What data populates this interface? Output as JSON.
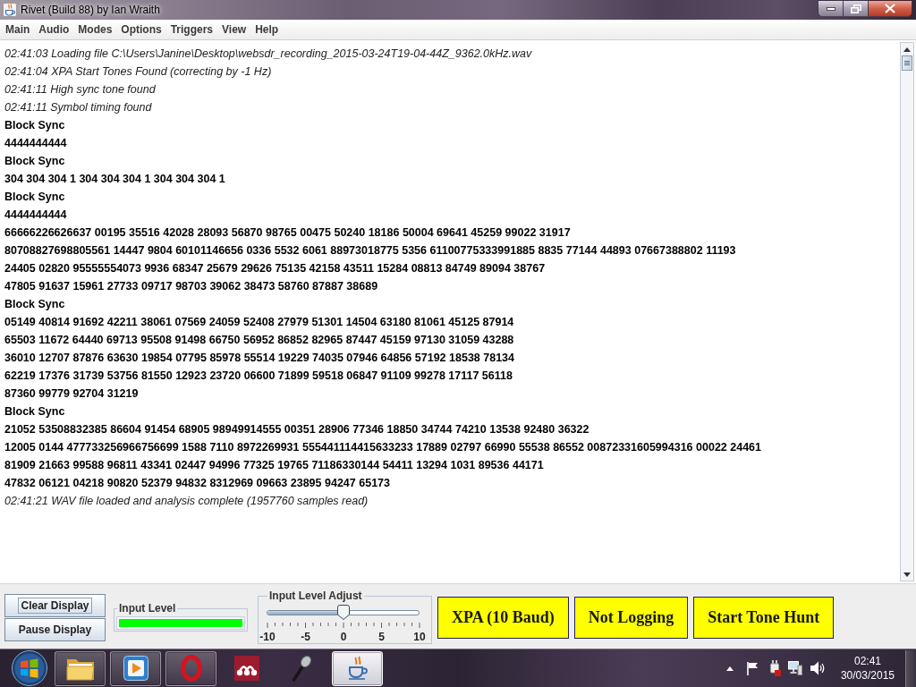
{
  "window": {
    "title": "Rivet (Build 88) by Ian Wraith"
  },
  "menu": [
    "Main",
    "Audio",
    "Modes",
    "Options",
    "Triggers",
    "View",
    "Help"
  ],
  "log": [
    {
      "kind": "status",
      "text": "02:41:03 Loading file C:\\Users\\Janine\\Desktop\\websdr_recording_2015-03-24T19-04-44Z_9362.0kHz.wav"
    },
    {
      "kind": "status",
      "text": "02:41:04 XPA Start Tones Found (correcting by -1 Hz)"
    },
    {
      "kind": "status",
      "text": "02:41:11 High sync tone found"
    },
    {
      "kind": "status",
      "text": "02:41:11 Symbol timing found"
    },
    {
      "kind": "data",
      "text": "Block Sync"
    },
    {
      "kind": "data",
      "text": "4444444444"
    },
    {
      "kind": "data",
      "text": "Block Sync"
    },
    {
      "kind": "data",
      "text": "304 304 304 1 304 304 304 1 304 304 304 1"
    },
    {
      "kind": "data",
      "text": "Block Sync"
    },
    {
      "kind": "data",
      "text": "4444444444"
    },
    {
      "kind": "data",
      "text": "66666226626637 00195 35516 42028 28093 56870 98765 00475 50240 18186 50004 69641 45259 99022 31917"
    },
    {
      "kind": "data",
      "text": "80708827698805561 14447 9804 60101146656 0336 5532 6061 88973018775 5356 61100775333991885 8835 77144 44893 07667388802 11193"
    },
    {
      "kind": "data",
      "text": "24405 02820 95555554073 9936 68347 25679 29626 75135 42158 43511 15284 08813 84749 89094 38767"
    },
    {
      "kind": "data",
      "text": "47805 91637 15961 27733 09717 98703 39062 38473 58760 87887 38689"
    },
    {
      "kind": "data",
      "text": "Block Sync"
    },
    {
      "kind": "data",
      "text": "05149 40814 91692 42211 38061 07569 24059 52408 27979 51301 14504 63180 81061 45125 87914"
    },
    {
      "kind": "data",
      "text": "65503 11672 64440 69713 95508 91498 66750 56952 86852 82965 87447 45159 97130 31059 43288"
    },
    {
      "kind": "data",
      "text": "36010 12707 87876 63630 19854 07795 85978 55514 19229 74035 07946 64856 57192 18538 78134"
    },
    {
      "kind": "data",
      "text": "62219 17376 31739 53756 81550 12923 23720 06600 71899 59518 06847 91109 99278 17117 56118"
    },
    {
      "kind": "data",
      "text": "87360 99779 92704 31219"
    },
    {
      "kind": "data",
      "text": "Block Sync"
    },
    {
      "kind": "data",
      "text": "21052 53508832385 86604 91454 68905 98949914555 00351 28906 77346 18850 34744 74210 13538 92480 36322"
    },
    {
      "kind": "data",
      "text": "12005 0144 477733256966756699 1588 7110 8972269931 555441114415633233 17889 02797 66990 55538 86552 00872331605994316 00022 24461"
    },
    {
      "kind": "data",
      "text": "81909 21663 99588 96811 43341 02447 94996 77325 19765 71186330144 54411 13294 1031 89536 44171"
    },
    {
      "kind": "data",
      "text": "47832 06121 04218 90820 52379 94832 8312969 09663 23895 94247 65173"
    },
    {
      "kind": "status",
      "text": "02:41:21 WAV file loaded and analysis complete (1957760 samples read)"
    }
  ],
  "controls": {
    "buttons": [
      {
        "label": "Clear Display",
        "focused": true
      },
      {
        "label": "Pause Display",
        "focused": false
      }
    ],
    "input_level": {
      "title": "Input Level",
      "level": 1
    },
    "input_level_adjust": {
      "title": "Input Level Adjust",
      "level": 0.5,
      "tick_labels": [
        "-10",
        "-5",
        "0",
        "5",
        "10"
      ]
    },
    "status_buttons": [
      "XPA (10 Baud)",
      "Not Logging",
      "Start Tone Hunt"
    ]
  },
  "taskbar": {
    "items": [
      {
        "kind": "folder",
        "running": true,
        "selected": false
      },
      {
        "kind": "player",
        "running": true,
        "selected": false
      },
      {
        "kind": "ring",
        "running": true,
        "selected": false
      },
      {
        "kind": "dots",
        "running": false,
        "selected": false
      },
      {
        "kind": "microphone",
        "running": false,
        "selected": false
      },
      {
        "kind": "cup",
        "running": true,
        "selected": true
      }
    ],
    "clock": {
      "time": "02:41",
      "date": "30/03/2015"
    }
  }
}
